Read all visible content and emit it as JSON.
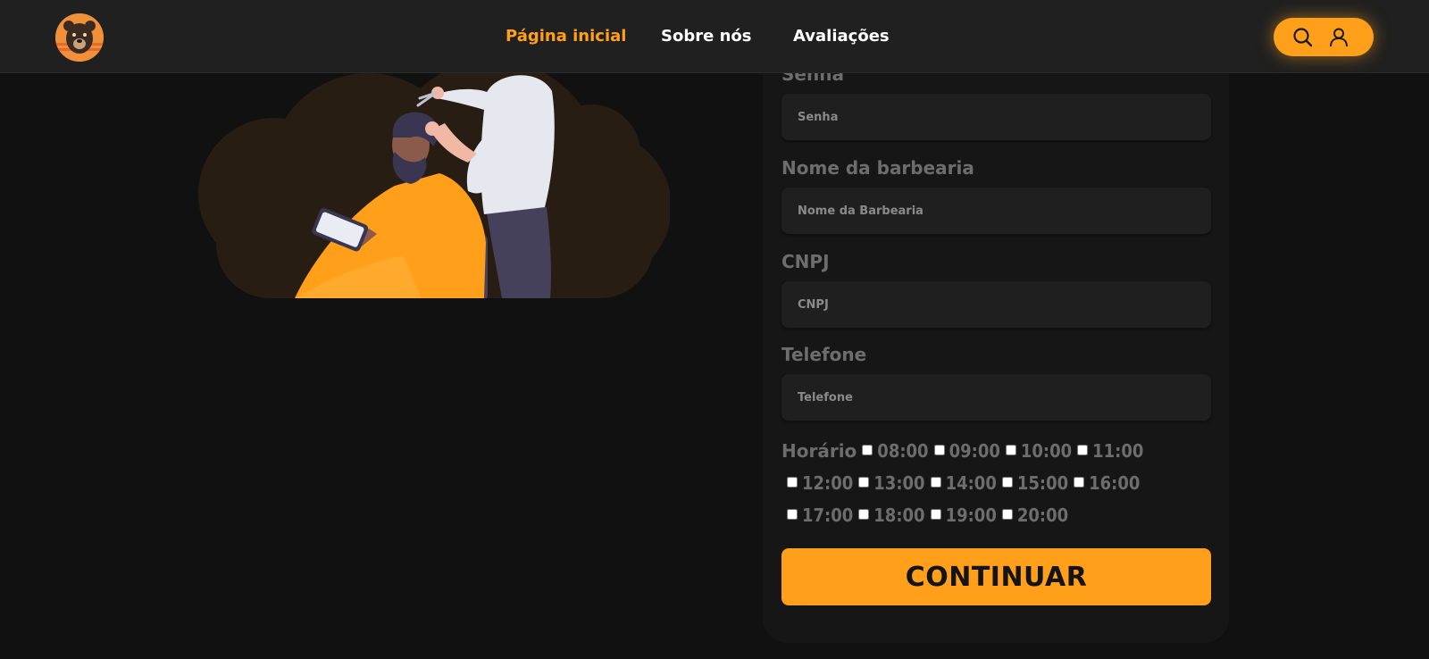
{
  "header": {
    "logo_icon": "bear-logo-icon",
    "nav": [
      {
        "label": "Página inicial",
        "active": true
      },
      {
        "label": "Sobre nós",
        "active": false
      },
      {
        "label": "Avaliações",
        "active": false
      }
    ],
    "actions": {
      "search_icon": "search-icon",
      "user_icon": "user-icon"
    }
  },
  "hero": {
    "illustration": "barber-cutting-hair-illustration"
  },
  "form": {
    "fields": [
      {
        "label": "Senha",
        "placeholder": "Senha"
      },
      {
        "label": "Nome da barbearia",
        "placeholder": "Nome da Barbearia"
      },
      {
        "label": "CNPJ",
        "placeholder": "CNPJ"
      },
      {
        "label": "Telefone",
        "placeholder": "Telefone"
      }
    ],
    "schedule": {
      "label": "Horário",
      "slots": [
        "08:00",
        "09:00",
        "10:00",
        "11:00",
        "12:00",
        "13:00",
        "14:00",
        "15:00",
        "16:00",
        "17:00",
        "18:00",
        "19:00",
        "20:00"
      ]
    },
    "submit_label": "CONTINUAR"
  },
  "colors": {
    "accent": "#ff9f1a",
    "background": "#111111",
    "header": "#202020",
    "input": "#1f1f1f",
    "label": "#6d6d6d"
  }
}
